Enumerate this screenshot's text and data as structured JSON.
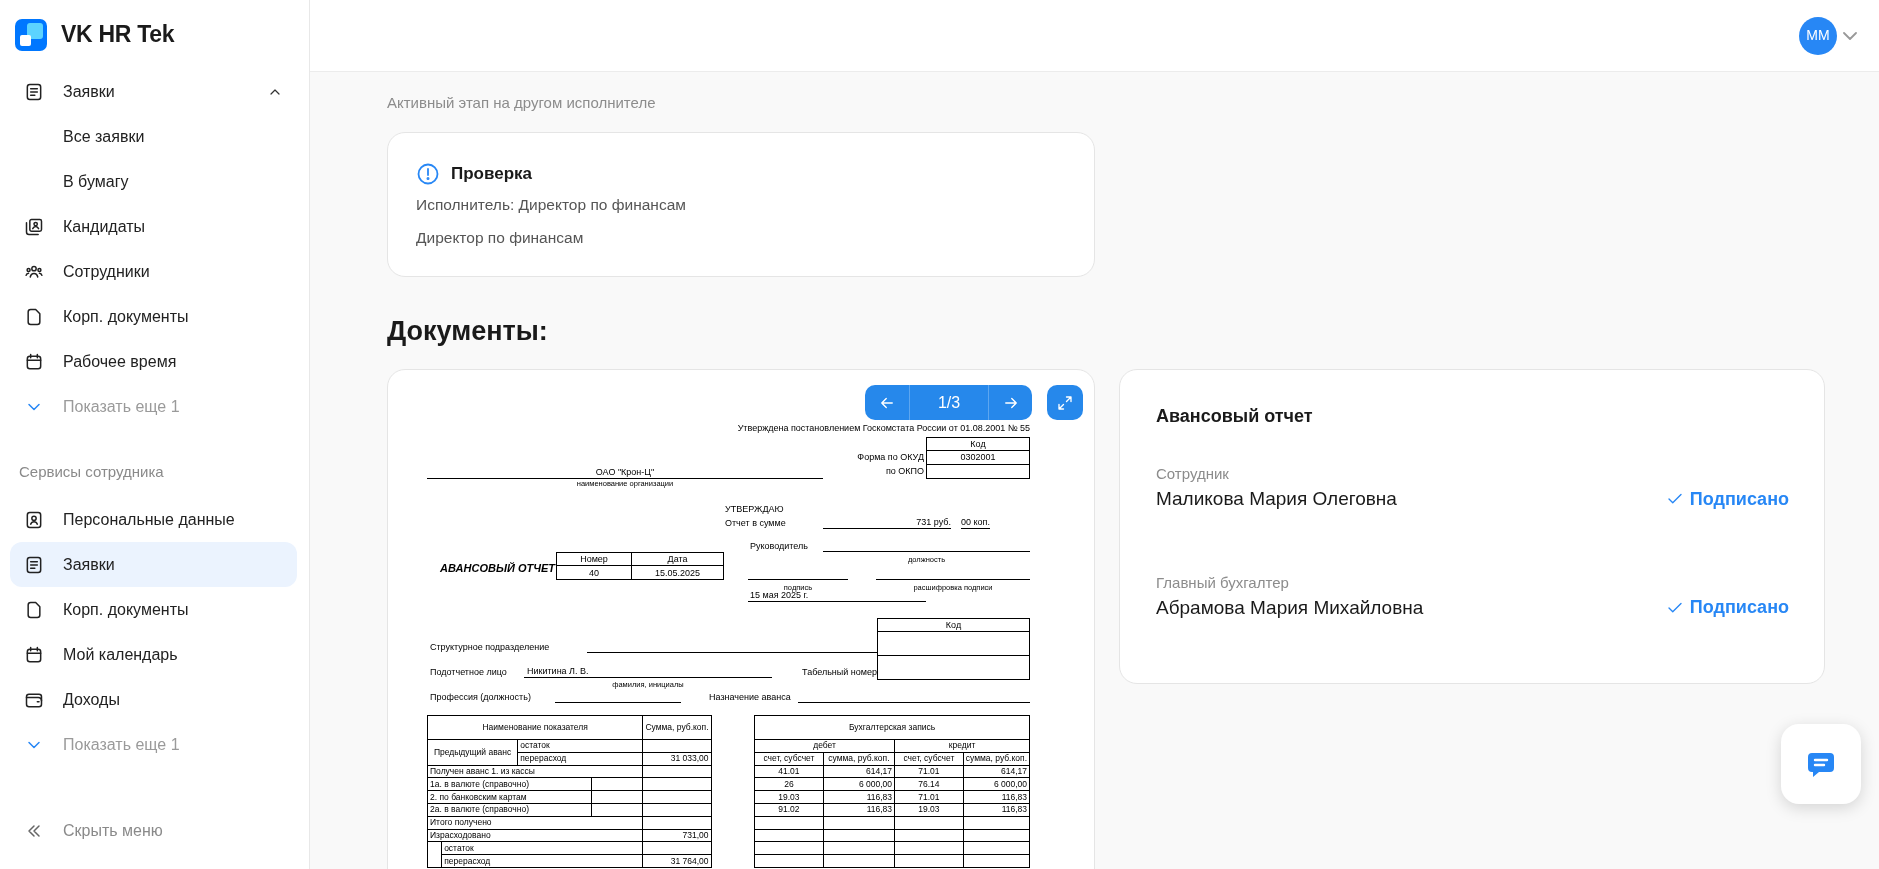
{
  "sidebar": {
    "logo": "VK HR Tek",
    "sections": [
      {
        "items": [
          {
            "kind": "link",
            "label": "Заявки",
            "selected": false,
            "expanded": true,
            "children": [
              {
                "label": "Все заявки",
                "selected": false
              },
              {
                "label": "В бумагу",
                "selected": false
              }
            ]
          },
          {
            "kind": "link",
            "label": "Кандидаты",
            "selected": false
          },
          {
            "kind": "link",
            "label": "Сотрудники",
            "selected": false
          },
          {
            "kind": "link",
            "label": "Корп. документы",
            "selected": false
          },
          {
            "kind": "link",
            "label": "Рабочее время",
            "selected": false
          },
          {
            "kind": "more",
            "label": "Показать еще 1",
            "selected": false
          }
        ]
      },
      {
        "title": "Сервисы сотрудника",
        "items": [
          {
            "kind": "link",
            "label": "Персональные данные",
            "selected": false
          },
          {
            "kind": "link",
            "label": "Заявки",
            "selected": true
          },
          {
            "kind": "link",
            "label": "Корп. документы",
            "selected": false
          },
          {
            "kind": "link",
            "label": "Мой календарь",
            "selected": false
          },
          {
            "kind": "link",
            "label": "Доходы",
            "selected": false
          },
          {
            "kind": "more",
            "label": "Показать еще 1",
            "selected": false
          }
        ]
      }
    ],
    "collapse": "Скрыть меню"
  },
  "header": {
    "avatar": "ММ"
  },
  "stage": {
    "note": "Активный этап на другом исполнителе",
    "title": "Проверка",
    "lines": [
      "Исполнитель: Директор по финансам",
      "Директор по финансам"
    ]
  },
  "documents_title": "Документы:",
  "viewer": {
    "page": "1/3",
    "document": {
      "approval": "Утверждена постановлением Госкомстата России от 01.08.2001 № 55",
      "org": {
        "name": "ОАО \"Крон-Ц\"",
        "caption": "наименование организации"
      },
      "codes": {
        "header": "Код",
        "rows": [
          {
            "label": "Форма по ОКУД",
            "value": "0302001"
          },
          {
            "label": "по ОКПО"
          }
        ]
      },
      "approve": {
        "title": "УТВЕРЖДАЮ",
        "sum_label": "Отчет в сумме",
        "rub": "731 руб.",
        "kop": "00 коп.",
        "head_label": "Руководитель",
        "position_caption": "должность",
        "signature_caption": "подпись",
        "decode_caption": "расшифровка подписи",
        "date": "15 мая 2025 г."
      },
      "title": "АВАНСОВЫЙ ОТЧЕТ",
      "number": {
        "label": "Номер",
        "value": "40"
      },
      "date": {
        "label": "Дата",
        "value": "15.05.2025"
      },
      "person_codes": {
        "header": "Код"
      },
      "unit_label": "Структурное подразделение",
      "person": {
        "label": "Подотчетное лицо",
        "value": "Никитина Л. В.",
        "caption": "фамилия, инициалы"
      },
      "tab_label": "Табельный номер",
      "profession_label": "Профессия (должность)",
      "purpose_label": "Назначение аванса",
      "ledger": {
        "name_header": "Наименование показателя",
        "sum_header": "Сумма, руб.коп.",
        "entry_header": "Бухгалтерская запись",
        "sides": [
          "дебет",
          "кредит"
        ],
        "subheaders": [
          "счет, субсчет",
          "сумма, руб.коп.",
          "счет, субсчет",
          "сумма, руб.коп."
        ],
        "rows": [
          {
            "kind": "group",
            "label": "Предыдущий аванс",
            "items": [
              {
                "label": "остаток"
              },
              {
                "label": "перерасход",
                "sum": "31 033,00"
              }
            ]
          },
          {
            "kind": "full",
            "label": "Получен аванс 1. из кассы",
            "entries": [
              "41.01",
              "614,17",
              "71.01",
              "614,17"
            ]
          },
          {
            "kind": "split",
            "label": "1а. в валюте (справочно)",
            "entries": [
              "26",
              "6 000,00",
              "76.14",
              "6 000,00"
            ]
          },
          {
            "kind": "split",
            "label": "2. по банковским картам",
            "entries": [
              "19.03",
              "116,83",
              "71.01",
              "116,83"
            ]
          },
          {
            "kind": "split",
            "label": "2а. в валюте (справочно)",
            "entries": [
              "91.02",
              "116,83",
              "19.03",
              "116,83"
            ]
          },
          {
            "kind": "full",
            "label": "Итого получено"
          },
          {
            "kind": "full",
            "label": "Израсходовано",
            "sum": "731,00"
          },
          {
            "kind": "indent",
            "items": [
              {
                "label": "остаток"
              },
              {
                "label": "перерасход",
                "sum": "31 764,00"
              }
            ]
          }
        ]
      }
    }
  },
  "signatures": {
    "title": "Авансовый отчет",
    "signers": [
      {
        "role": "Сотрудник",
        "name": "Маликова Мария Олеговна",
        "status": "Подписано",
        "signed": true
      },
      {
        "role": "Главный бухгалтер",
        "name": "Абрамова Мария Михайловна",
        "status": "Подписано",
        "signed": true
      }
    ]
  }
}
